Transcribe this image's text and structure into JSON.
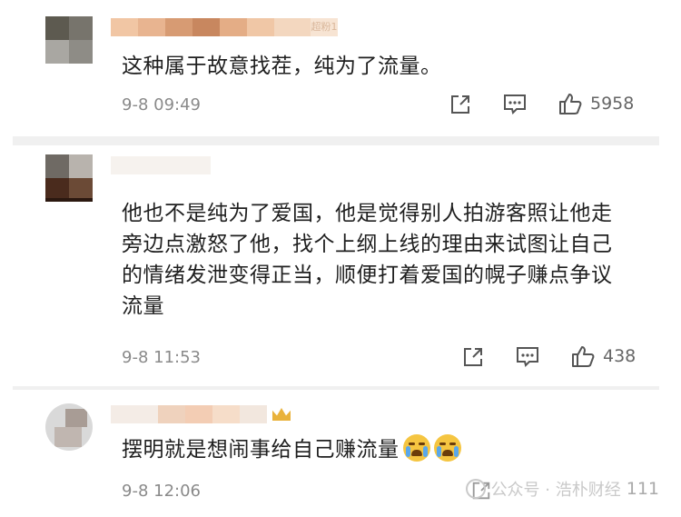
{
  "comments": [
    {
      "text": "这种属于故意找茬，纯为了流量。",
      "time": "9-8 09:49",
      "likes": "5958",
      "username_tag": "超粉1"
    },
    {
      "text": "他也不是纯为了爱国，他是觉得别人拍游客照让他走旁边点激怒了他，找个上纲上线的理由来试图让自己的情绪发泄变得正当，顺便打着爱国的幌子赚点争议流量",
      "time": "9-8 11:53",
      "likes": "438"
    },
    {
      "text": "摆明就是想闹事给自己赚流量",
      "time": "9-8 12:06",
      "likes": "111"
    }
  ],
  "icons": {
    "share": "share-icon",
    "reply": "comment-icon",
    "like": "thumbs-up-icon",
    "emoji": "crying-emoji-icon",
    "badge": "crown-icon"
  },
  "watermark": "公众号 · 浩朴财经",
  "colors": {
    "separator": "#f0f0f0",
    "meta": "#8a8a8a",
    "text": "#1f1f1f"
  }
}
